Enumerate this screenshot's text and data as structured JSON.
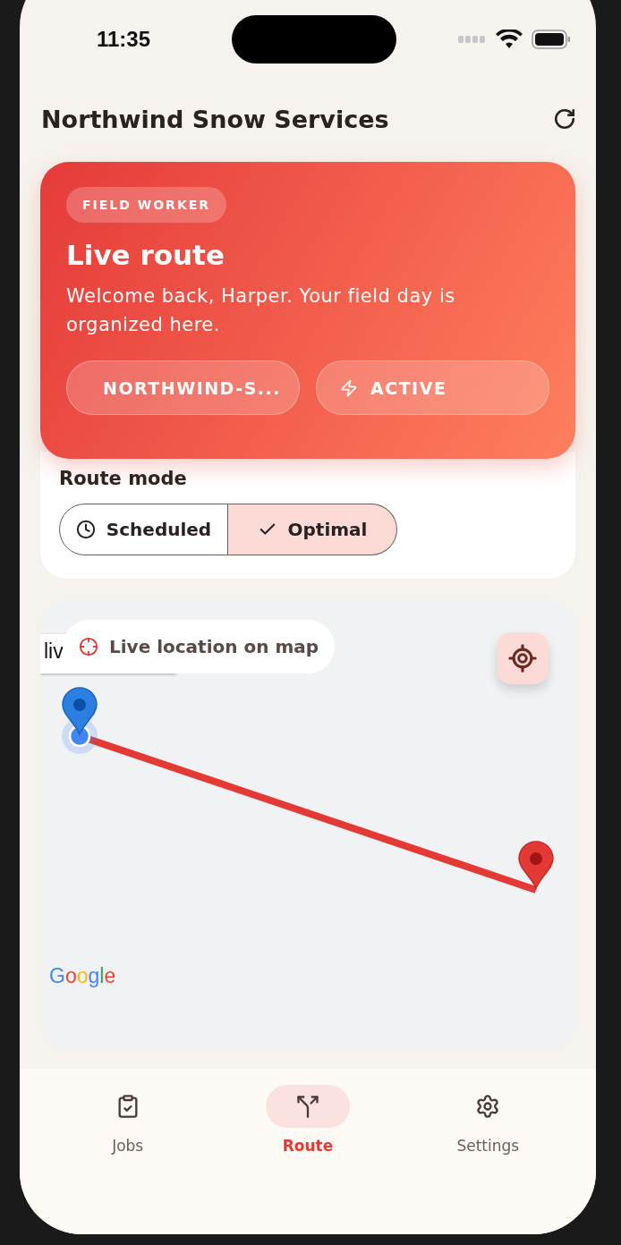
{
  "status_bar": {
    "time": "11:35"
  },
  "header": {
    "title": "Northwind Snow Services"
  },
  "hero": {
    "badge": "FIELD WORKER",
    "title": "Live route",
    "subtitle": "Welcome back, Harper. Your field day is organized here.",
    "chips": [
      {
        "kind": "org",
        "label": "NORTHWIND-S..."
      },
      {
        "kind": "status",
        "label": "ACTIVE"
      }
    ]
  },
  "route_mode": {
    "title": "Route mode",
    "options": [
      {
        "kind": "scheduled",
        "label": "Scheduled",
        "selected": false
      },
      {
        "kind": "optimal",
        "label": "Optimal",
        "selected": true
      }
    ]
  },
  "map": {
    "overlay_label": "Live location on map",
    "marker_tooltip": "liv",
    "attribution": "Google"
  },
  "tabs": [
    {
      "kind": "jobs",
      "label": "Jobs",
      "selected": false
    },
    {
      "kind": "route",
      "label": "Route",
      "selected": true
    },
    {
      "kind": "settings",
      "label": "Settings",
      "selected": false
    }
  ]
}
